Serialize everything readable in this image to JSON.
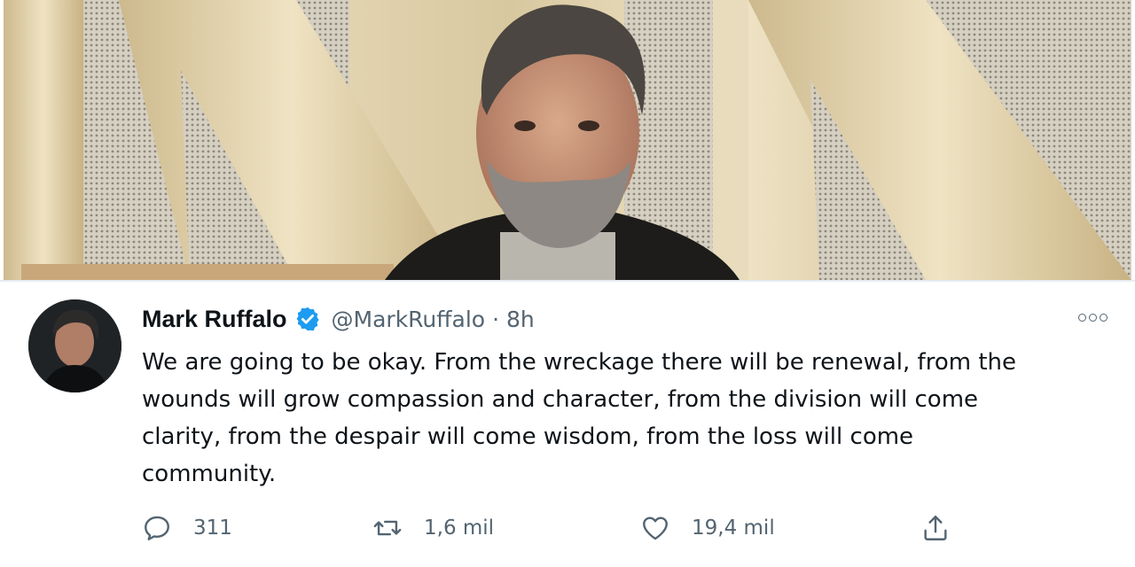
{
  "header_photo": {
    "alt_subject": "man with grey beard in front of gold metallic sign"
  },
  "tweet": {
    "display_name": "Mark Ruffalo",
    "verified": true,
    "handle": "@MarkRuffalo",
    "separator": "·",
    "time": "8h",
    "text": "We are going to be okay. From the wreckage there will be renewal, from the\nwounds will grow compassion and character, from the division will come\nclarity, from the despair will come wisdom, from the loss will come\ncommunity.",
    "replies": "311",
    "retweets": "1,6 mil",
    "likes": "19,4 mil"
  },
  "icons": {
    "reply": "reply-icon",
    "retweet": "retweet-icon",
    "like": "heart-icon",
    "share": "share-icon",
    "verified": "verified-badge-icon",
    "more": "more-options-icon"
  },
  "colors": {
    "accent": "#1d9bf0",
    "text": "#0f1419",
    "muted": "#536471"
  }
}
